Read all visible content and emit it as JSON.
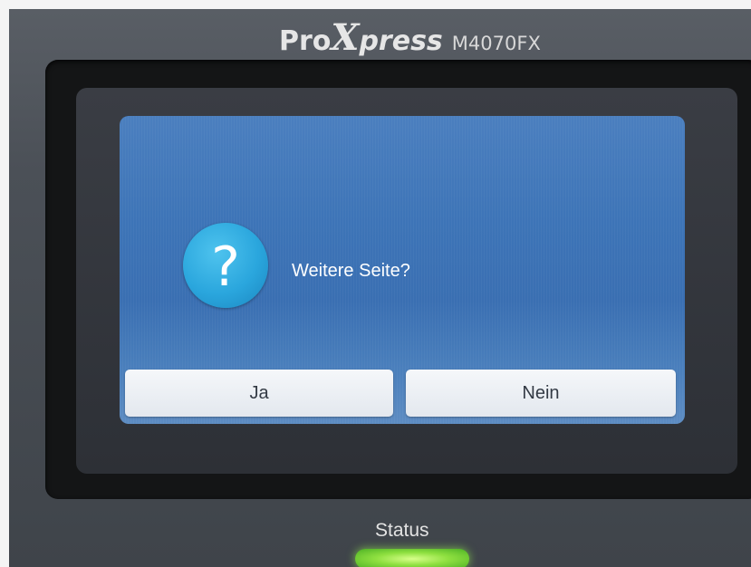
{
  "device": {
    "brand_pro": "Pro",
    "brand_x": "X",
    "brand_press": "press",
    "model": "M4070FX"
  },
  "dialog": {
    "icon": "question-icon",
    "icon_glyph": "?",
    "message": "Weitere Seite?",
    "buttons": {
      "yes_label": "Ja",
      "no_label": "Nein"
    }
  },
  "status": {
    "label": "Status",
    "led_color": "#8fe040"
  },
  "colors": {
    "screen_blue": "#3d74b7",
    "icon_blue": "#2aa6dd",
    "button_bg": "#eef1f5"
  }
}
